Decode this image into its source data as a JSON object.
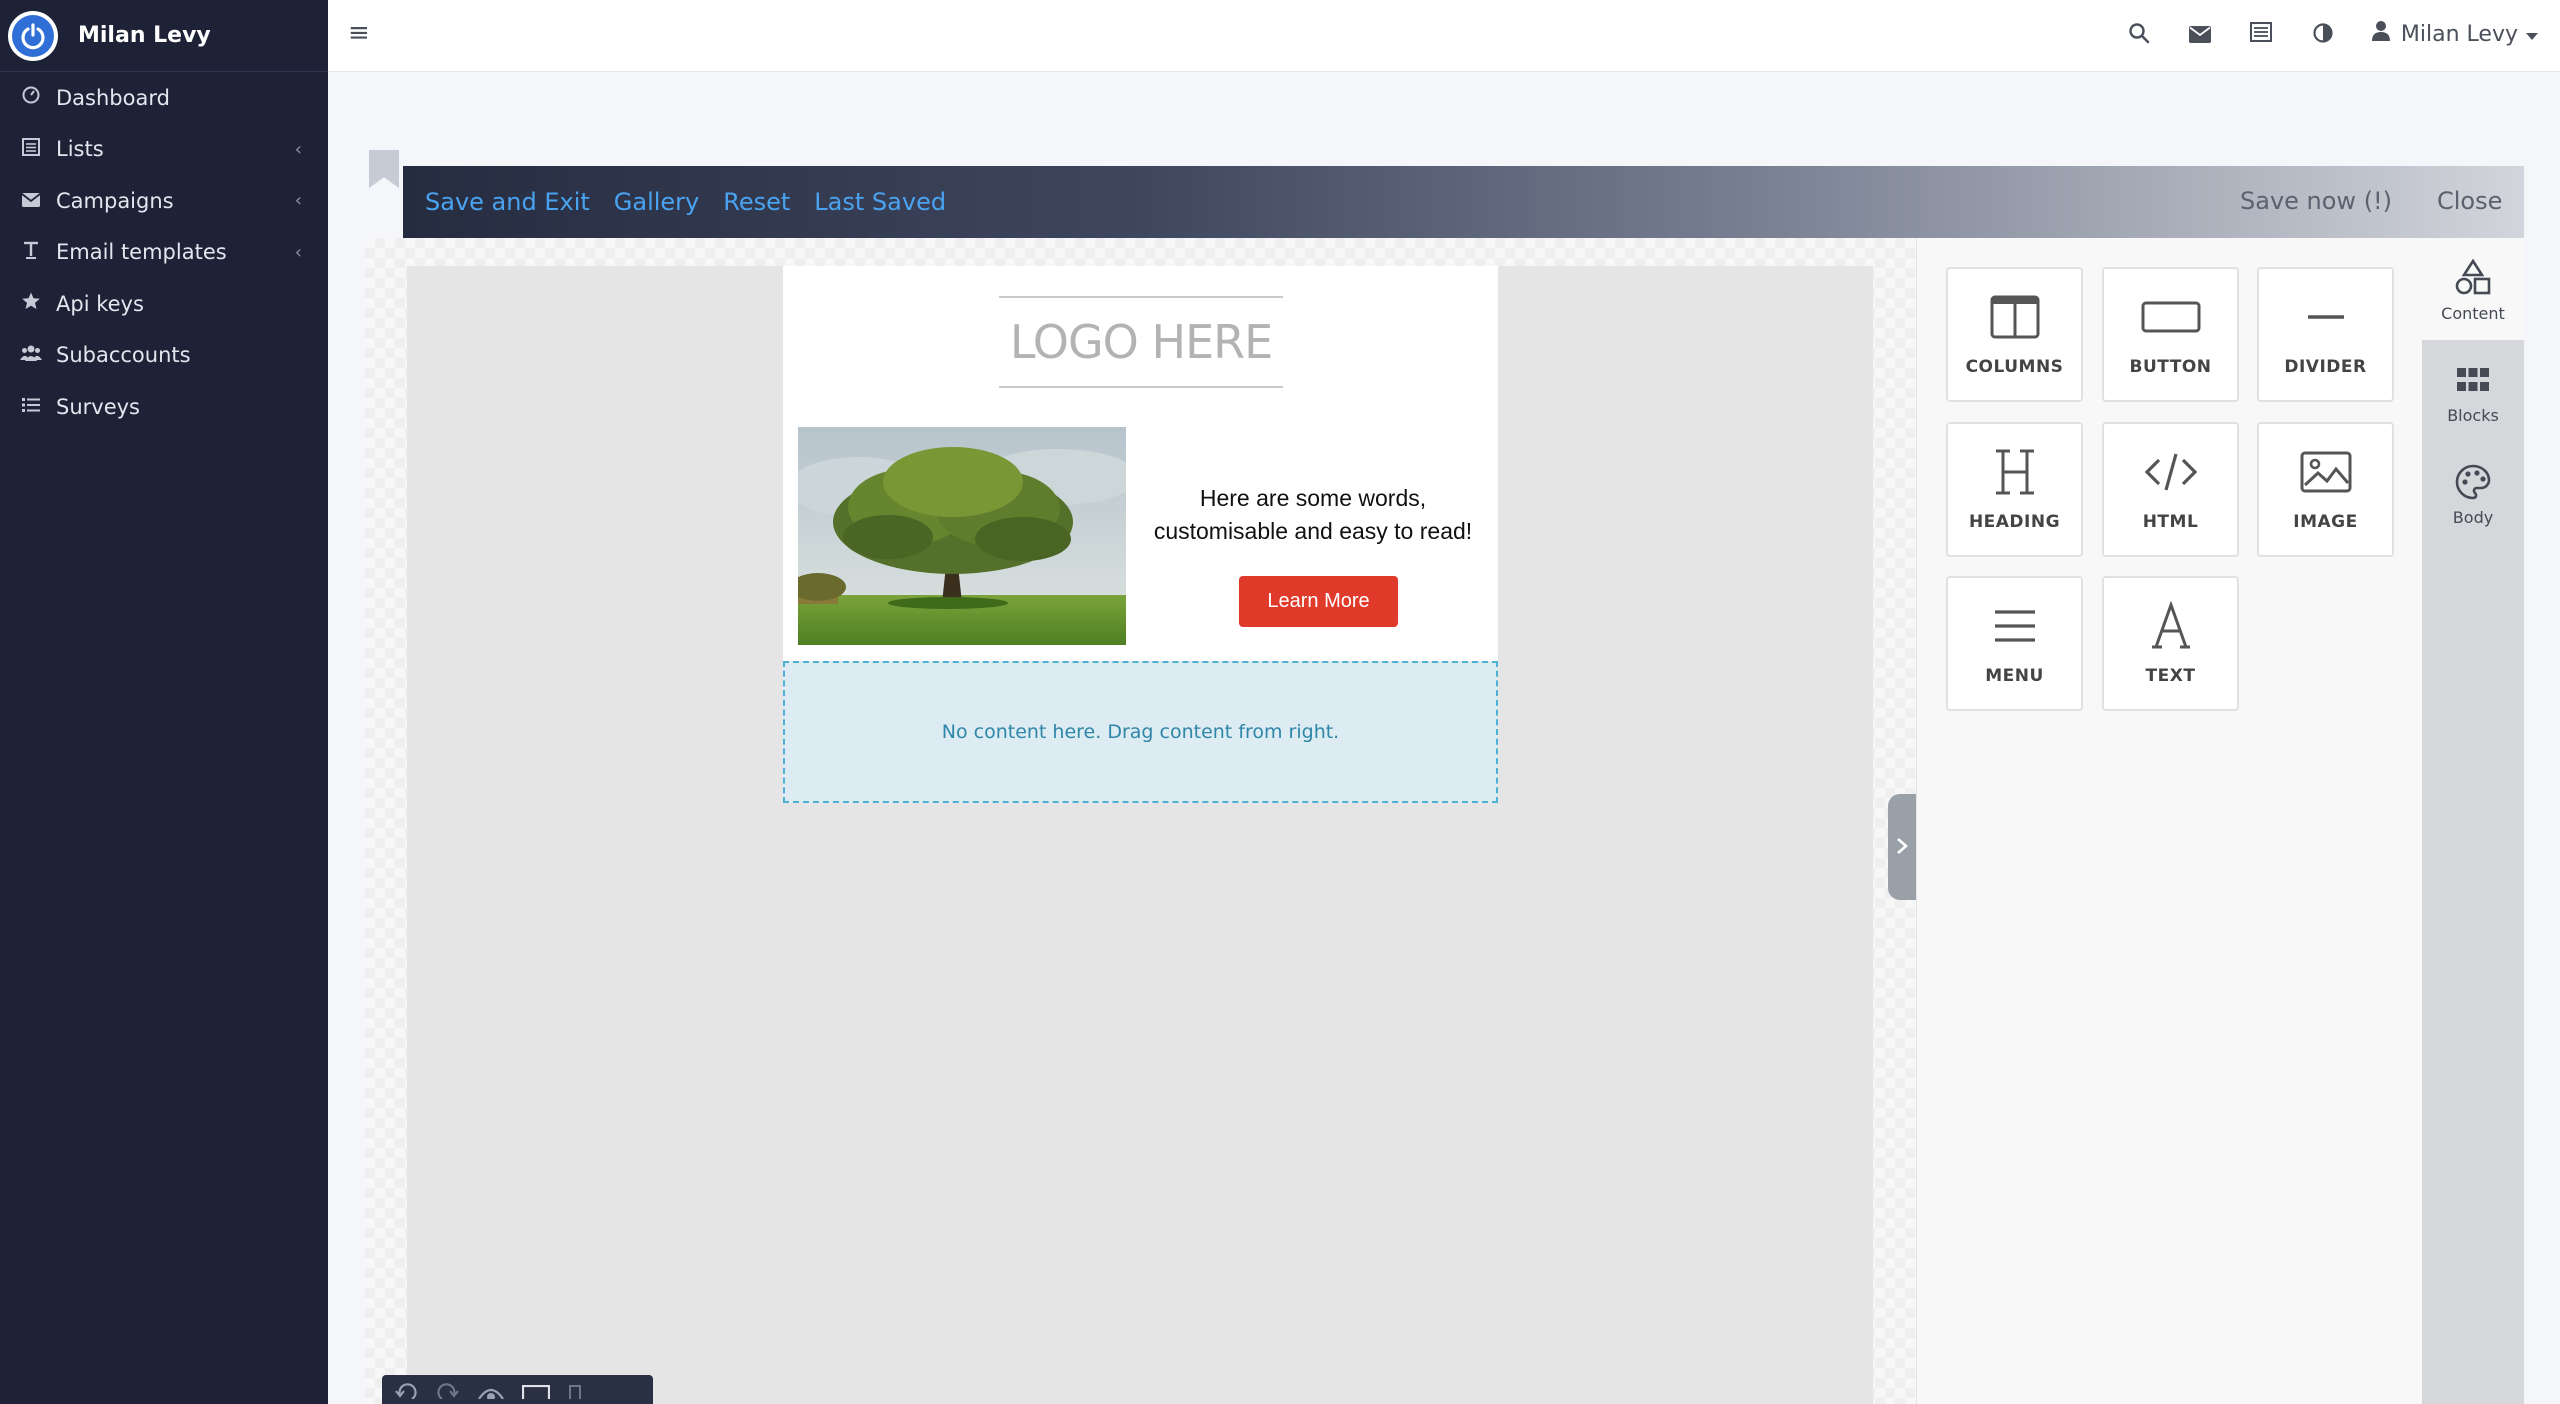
{
  "sidebar": {
    "brand_name": "Milan Levy",
    "items": [
      {
        "label": "Dashboard",
        "icon": "dashboard-icon",
        "has_chevron": false
      },
      {
        "label": "Lists",
        "icon": "list-icon",
        "has_chevron": true
      },
      {
        "label": "Campaigns",
        "icon": "envelope-icon",
        "has_chevron": true
      },
      {
        "label": "Email templates",
        "icon": "text-icon",
        "has_chevron": true
      },
      {
        "label": "Api keys",
        "icon": "star-icon",
        "has_chevron": false
      },
      {
        "label": "Subaccounts",
        "icon": "users-icon",
        "has_chevron": false
      },
      {
        "label": "Surveys",
        "icon": "list-icon",
        "has_chevron": false
      }
    ],
    "chevron_glyph": "‹"
  },
  "topbar": {
    "menu_glyph": "≡",
    "user_name": "Milan Levy"
  },
  "editor_bar": {
    "save_exit": "Save and Exit",
    "gallery": "Gallery",
    "reset": "Reset",
    "last_saved": "Last Saved",
    "save_now": "Save now (!)",
    "close": "Close"
  },
  "email": {
    "logo_text": "LOGO HERE",
    "hero_text_line1": "Here are some words,",
    "hero_text_line2": "customisable and easy to read!",
    "cta_label": "Learn More",
    "dropzone_text": "No content here. Drag content from right."
  },
  "content_tiles": [
    {
      "label": "COLUMNS",
      "icon": "columns-icon"
    },
    {
      "label": "BUTTON",
      "icon": "button-icon"
    },
    {
      "label": "DIVIDER",
      "icon": "divider-icon"
    },
    {
      "label": "HEADING",
      "icon": "heading-icon"
    },
    {
      "label": "HTML",
      "icon": "code-icon"
    },
    {
      "label": "IMAGE",
      "icon": "image-icon"
    },
    {
      "label": "MENU",
      "icon": "menu-icon"
    },
    {
      "label": "TEXT",
      "icon": "text-icon"
    }
  ],
  "panel_tabs": [
    {
      "label": "Content",
      "icon": "shapes-icon",
      "active": true
    },
    {
      "label": "Blocks",
      "icon": "grid-icon",
      "active": false
    },
    {
      "label": "Body",
      "icon": "palette-icon",
      "active": false
    }
  ],
  "colors": {
    "sidebar_bg": "#1e2236",
    "accent_link": "#4aa3f0",
    "cta": "#e03a2b",
    "dropzone_bg": "#dcecf2"
  }
}
